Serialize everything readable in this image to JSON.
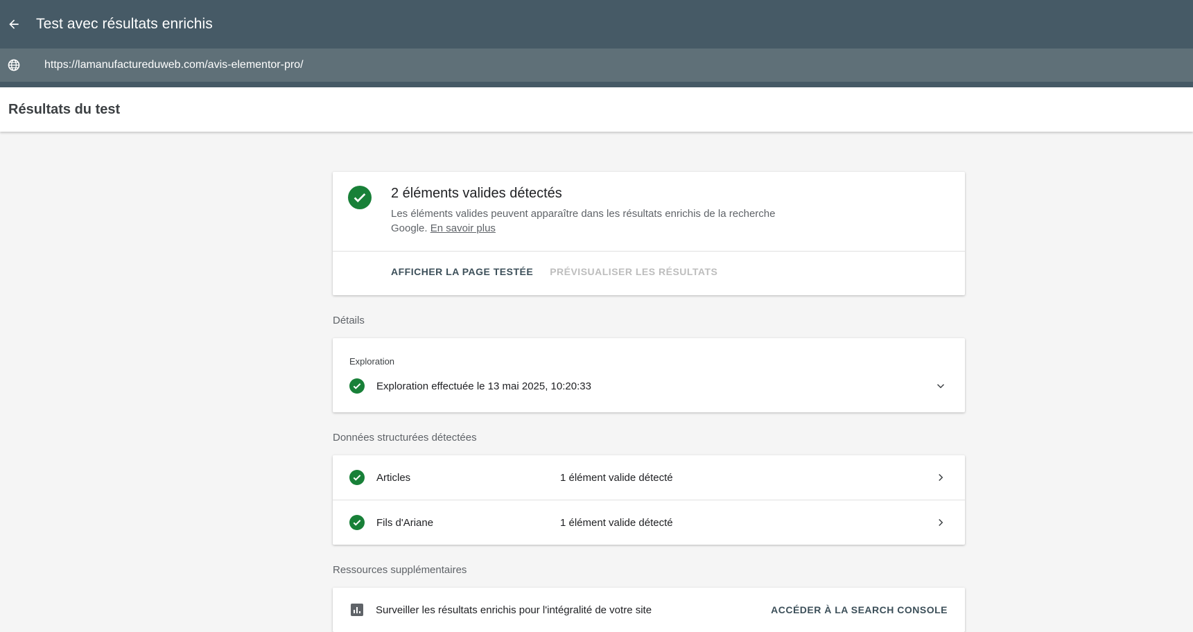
{
  "header": {
    "title": "Test avec résultats enrichis",
    "url": "https://lamanufactureduweb.com/avis-elementor-pro/"
  },
  "subheader": {
    "title": "Résultats du test"
  },
  "summary": {
    "title": "2 éléments valides détectés",
    "description": "Les éléments valides peuvent apparaître dans les résultats enrichis de la recherche Google.",
    "learn_more": "En savoir plus",
    "view_page_button": "AFFICHER LA PAGE TESTÉE",
    "preview_button": "PRÉVISUALISER LES RÉSULTATS"
  },
  "details": {
    "section_label": "Détails",
    "exploration_label": "Exploration",
    "exploration_status": "Exploration effectuée le 13 mai 2025, 10:20:33"
  },
  "structured_data": {
    "section_label": "Données structurées détectées",
    "items": [
      {
        "name": "Articles",
        "status": "1 élément valide détecté"
      },
      {
        "name": "Fils d'Ariane",
        "status": "1 élément valide détecté"
      }
    ]
  },
  "resources": {
    "section_label": "Ressources supplémentaires",
    "text": "Surveiller les résultats enrichis pour l'intégralité de votre site",
    "link": "ACCÉDER À LA SEARCH CONSOLE"
  },
  "colors": {
    "header_bg": "#465a66",
    "urlbar_bg": "#5f7078",
    "valid_green": "#188038",
    "page_bg": "#f5f5f5"
  },
  "icons": {
    "back": "arrow-left-icon",
    "globe": "globe-icon",
    "check": "check-circle-icon",
    "chevron_down": "chevron-down-icon",
    "chevron_right": "chevron-right-icon",
    "chart": "bar-chart-icon"
  }
}
